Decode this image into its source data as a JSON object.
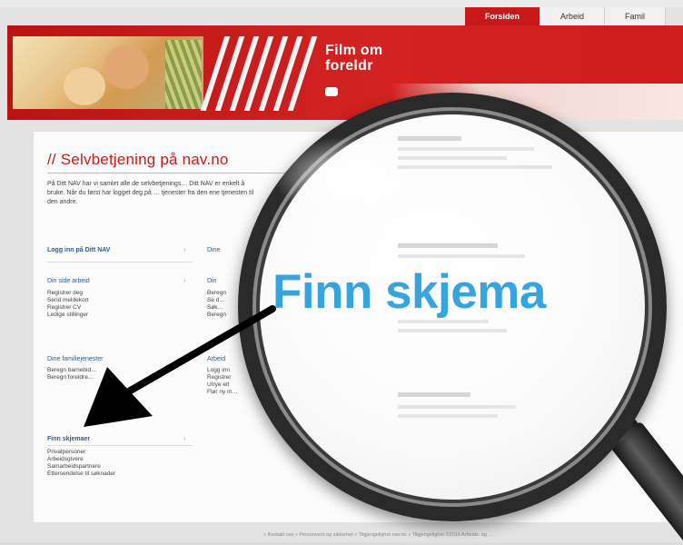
{
  "tabs": [
    {
      "label": "Forsiden",
      "active": true
    },
    {
      "label": "Arbeid",
      "active": false
    },
    {
      "label": "Famil",
      "active": false
    }
  ],
  "banner": {
    "title_line1": "Film om",
    "title_line2": "foreldr"
  },
  "page": {
    "title": "// Selvbetjening på nav.no",
    "intro": "På Ditt NAV har vi samlet alle de selvbetjenings… Ditt NAV er enkelt å bruke. Når du først har logget deg på … tjenester fra den ene tjenesten til den andre."
  },
  "left_column": {
    "login": "Logg inn på Ditt NAV",
    "din_side_arbeid": {
      "title": "Din side arbeid",
      "items": [
        "Registrer deg",
        "Send meldekort",
        "Registrer CV",
        "Ledige stillinger"
      ]
    },
    "familie": {
      "title": "Dine familiejenester",
      "items": [
        "Beregn barnebid…",
        "Beregn foreldre…"
      ]
    },
    "skjema": {
      "title": "Finn skjemaer",
      "items": [
        "Privatpersoner",
        "Arbeidsgivere",
        "Samarbeidspartnere",
        "Ettersendelse til søknader"
      ]
    }
  },
  "middle_column": {
    "heads": [
      "Dine",
      "Din",
      "Arbeid"
    ],
    "lines": [
      "Beregn",
      "Se d…",
      "Søk…",
      "Beregn",
      "Logg inn",
      "Registrer",
      "Utrye elt",
      "Flør ny m…"
    ]
  },
  "magnifier": {
    "label": "Finn skjema"
  },
  "footer": {
    "links": "» Kontakt oss   » Personvern og sikkerhet   » Tilgjengelighet nav.no   » Tilgjengelighet   ©2010 Arbeids- og …"
  },
  "colors": {
    "brand_red": "#c8191a",
    "link_blue": "#2c5c9a",
    "highlight_blue": "#36a4dd"
  }
}
